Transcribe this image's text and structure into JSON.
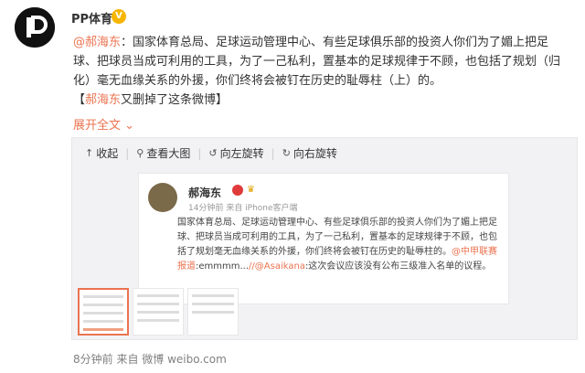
{
  "post": {
    "username": "PP体育",
    "verified": "V",
    "mention": "@郝海东",
    "text": "：国家体育总局、足球运动管理中心、有些足球俱乐部的投资人你们为了媚上把足球、把球员当成可利用的工具，为了一己私利，置基本的足球规律于不顾，也包括了规划（归化）毫无血缘关系的外援，你们终将会被钉在历史的耻辱柱（上）的。",
    "note_open": "【",
    "note_link": "郝海东",
    "note_text": "又删掉了这条微博",
    "note_close": "】",
    "expand": "展开全文",
    "expand_icon": "chevron-down-icon"
  },
  "toolbar": {
    "collapse": "收起",
    "view_large": "查看大图",
    "rotate_left": "向左旋转",
    "rotate_right": "向右旋转"
  },
  "embedded": {
    "name": "郝海东",
    "meta": "14分钟前 来自 iPhone客户端",
    "text": "国家体育总局、足球运动管理中心、有些足球俱乐部的投资人你们为了媚上把足球、把球员当成可利用的工具，为了一己私利，置基本的足球规律于不顾，也包括了规划毫无血缘关系的外援，你们终将会被钉在历史的耻辱柱的。",
    "mention1": "@中甲联赛报道",
    "reply": ":emmmm...",
    "mention2": "//@Asaikana",
    "reply2": ":这次会议应该没有公布三级准入名单的议程。"
  },
  "footer": "8分钟前  来自 微博 weibo.com",
  "colors": {
    "accent": "#eb7350",
    "verified": "#f7b500"
  }
}
